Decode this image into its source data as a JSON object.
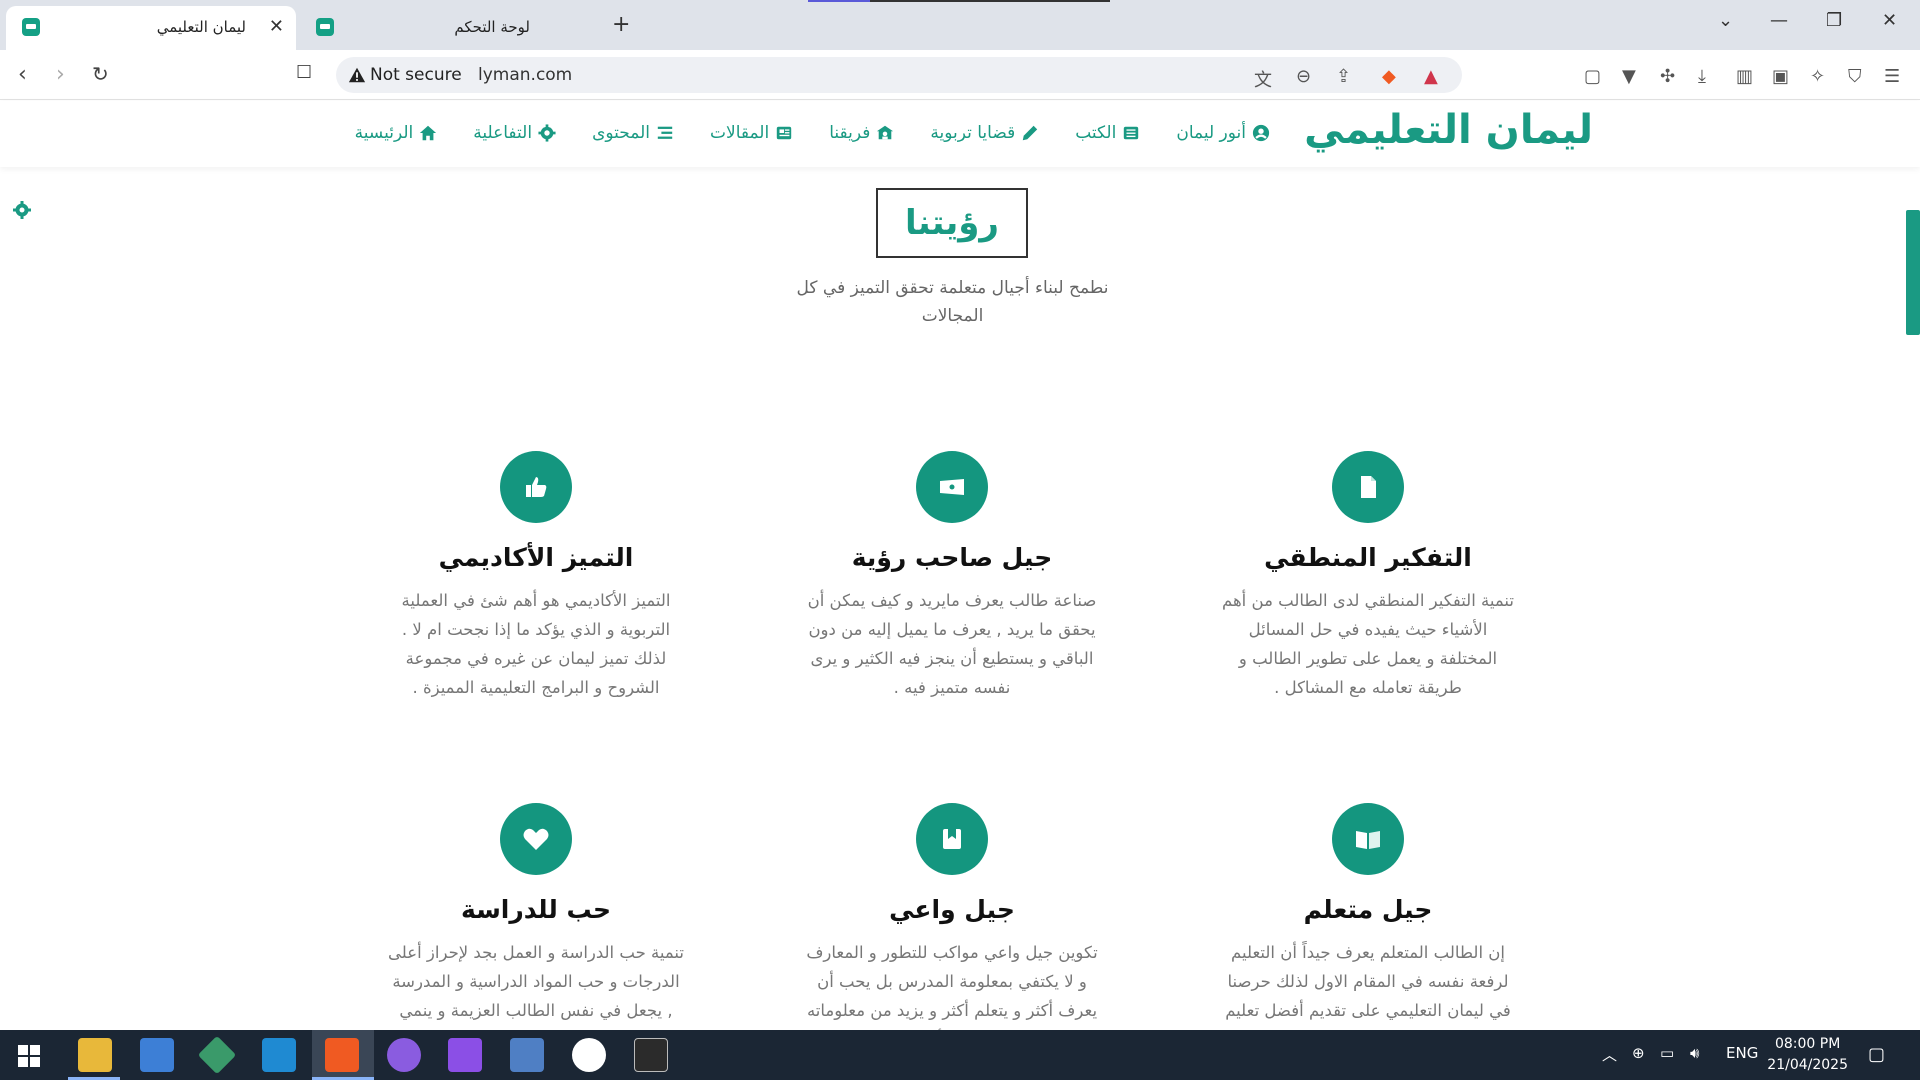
{
  "browser": {
    "tabs": [
      {
        "title": "ليمان التعليمي",
        "active": true
      },
      {
        "title": "لوحة التحكم",
        "active": false
      }
    ],
    "security_label": "Not secure",
    "url": "lyman.com"
  },
  "site": {
    "logo": "ليمان التعليمي",
    "accent_color": "#1a9a83",
    "nav": [
      {
        "label": "الرئيسية",
        "icon": "home-icon"
      },
      {
        "label": "التفاعلية",
        "icon": "gear-icon"
      },
      {
        "label": "المحتوى",
        "icon": "list-icon"
      },
      {
        "label": "المقالات",
        "icon": "newspaper-icon"
      },
      {
        "label": "فريقنا",
        "icon": "team-icon"
      },
      {
        "label": "قضايا تربوية",
        "icon": "pen-icon"
      },
      {
        "label": "الكتب",
        "icon": "book-icon"
      },
      {
        "label": "أنور ليمان",
        "icon": "user-circle-icon"
      }
    ]
  },
  "vision": {
    "title": "رؤيتنا",
    "text": "نطمح لبناء أجيال متعلمة تحقق التميز في كل المجالات"
  },
  "features": [
    {
      "title": "التفكير المنطقي",
      "icon": "document-icon",
      "desc": "تنمية التفكير المنطقي لدى الطالب من أهم الأشياء حيث يفيده في حل المسائل المختلفة و يعمل على تطوير الطالب و طريقة تعامله مع المشاكل ."
    },
    {
      "title": "جيل صاحب رؤية",
      "icon": "ticket-icon",
      "desc": "صناعة طالب يعرف مايريد و كيف يمكن أن يحقق ما يريد , يعرف ما يميل إليه من دون الباقي و يستطيع أن ينجز فيه الكثير و يرى نفسه متميز فيه ."
    },
    {
      "title": "التميز الأكاديمي",
      "icon": "thumbs-up-icon",
      "desc": "التميز الأكاديمي هو أهم شئ في العملية التربوية و الذي يؤكد ما إذا نجحت ام لا . لذلك تميز ليمان عن غيره في مجموعة الشروح و البرامج التعليمية المميزة ."
    },
    {
      "title": "جيل متعلم",
      "icon": "open-book-icon",
      "desc": "إن الطالب المتعلم يعرف جيداً أن التعليم لرفعة نفسه في المقام الاول لذلك حرصنا في ليمان التعليمي على تقديم أفضل تعليم"
    },
    {
      "title": "جيل واعي",
      "icon": "bookmark-icon",
      "desc": "تكوين جيل واعي مواكب للتطور و المعارف و لا يكتفي بمعلومة المدرس بل يحب أن يعرف أكثر و يتعلم أكثر و يزيد من معلوماته بشكل أكثر"
    },
    {
      "title": "حب للدراسة",
      "icon": "heart-icon",
      "desc": "تنمية حب الدراسة و العمل بجد لإحراز أعلى الدرجات و حب المواد الدراسية و المدرسة , يجعل في نفس الطالب العزيمة و ينمي روح"
    }
  ],
  "taskbar": {
    "language": "ENG",
    "time": "08:00 PM",
    "date": "21/04/2025"
  }
}
